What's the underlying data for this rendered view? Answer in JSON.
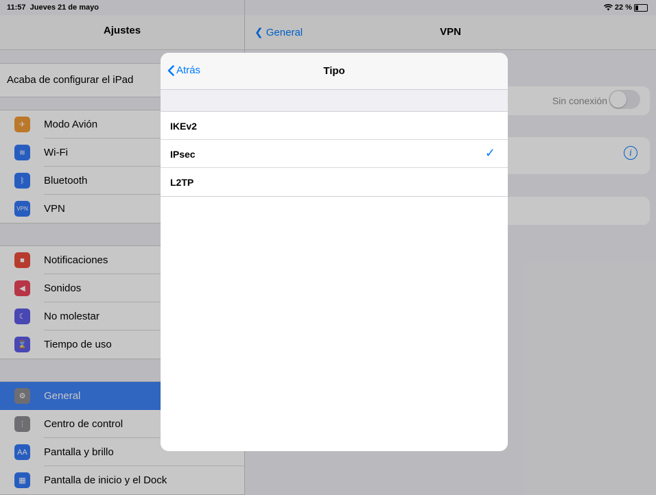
{
  "status_bar": {
    "time": "11:57",
    "date": "Jueves 21 de mayo",
    "wifi_icon": "wifi-icon",
    "battery_percent": "22 %",
    "battery_level": 0.22
  },
  "sidebar": {
    "title": "Ajustes",
    "setup_text": "Acaba de configurar el iPad",
    "groups": [
      [
        {
          "label": "Modo Avión",
          "icon": "airplane-icon",
          "color": "#f19a37"
        },
        {
          "label": "Wi-Fi",
          "icon": "wifi-icon",
          "color": "#3478f6"
        },
        {
          "label": "Bluetooth",
          "icon": "bluetooth-icon",
          "color": "#3478f6"
        },
        {
          "label": "VPN",
          "icon": "vpn-icon",
          "color": "#3478f6"
        }
      ],
      [
        {
          "label": "Notificaciones",
          "icon": "notifications-icon",
          "color": "#eb4d3d"
        },
        {
          "label": "Sonidos",
          "icon": "sounds-icon",
          "color": "#eb445a"
        },
        {
          "label": "No molestar",
          "icon": "moon-icon",
          "color": "#5e5ce6"
        },
        {
          "label": "Tiempo de uso",
          "icon": "hourglass-icon",
          "color": "#5e5ce6"
        }
      ],
      [
        {
          "label": "General",
          "icon": "gear-icon",
          "color": "#8e8e93",
          "selected": true
        },
        {
          "label": "Centro de control",
          "icon": "control-center-icon",
          "color": "#8e8e93"
        },
        {
          "label": "Pantalla y brillo",
          "icon": "display-icon",
          "color": "#3478f6"
        },
        {
          "label": "Pantalla de inicio y el Dock",
          "icon": "home-screen-icon",
          "color": "#3478f6"
        }
      ]
    ]
  },
  "detail": {
    "back_label": "General",
    "title": "VPN",
    "status_label": "Sin conexión",
    "info_icon": "info-icon"
  },
  "modal": {
    "back_label": "Atrás",
    "title": "Tipo",
    "options": [
      {
        "label": "IKEv2",
        "checked": false
      },
      {
        "label": "IPsec",
        "checked": true
      },
      {
        "label": "L2TP",
        "checked": false
      }
    ],
    "check_glyph": "✓"
  },
  "colors": {
    "accent": "#007aff",
    "selected_row": "#3e82f7"
  }
}
